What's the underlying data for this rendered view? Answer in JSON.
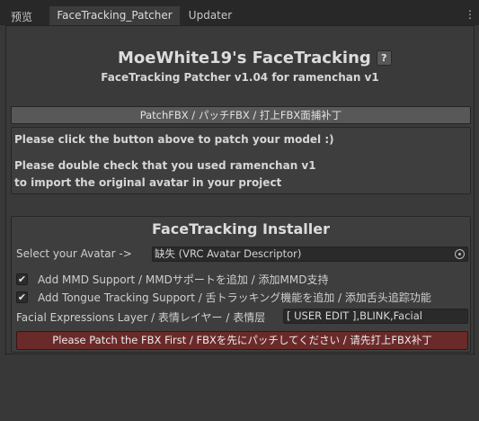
{
  "tabs": [
    {
      "label": "预览"
    },
    {
      "label": "FaceTracking_Patcher"
    },
    {
      "label": "Updater"
    }
  ],
  "tab_menu_glyph": "⋮",
  "header": {
    "title": "MoeWhite19's FaceTracking",
    "help_label": "?",
    "subtitle": "FaceTracking Patcher v1.04 for ramenchan v1"
  },
  "patch": {
    "button_label": "PatchFBX / パッチFBX / 打上FBX面捕补丁",
    "info_line1": "Please click the button above to patch your model :)",
    "info_line2": "Please double check that you used ramenchan v1",
    "info_line3": "to import the original avatar in your project"
  },
  "installer": {
    "title": "FaceTracking Installer",
    "avatar_label": "Select your Avatar ->",
    "avatar_value": "缺失 (VRC Avatar Descriptor)",
    "mmd_checked": true,
    "mmd_label": "Add MMD Support / MMDサポートを追加 / 添加MMD支持",
    "tongue_checked": true,
    "tongue_label": "Add Tongue Tracking Support / 舌トラッキング機能を追加 / 添加舌头追踪功能",
    "facial_label": "Facial Expressions Layer / 表情レイヤー / 表情层",
    "facial_value": "[ USER EDIT ],BLINK,Facial",
    "warning_label": "Please Patch the FBX First / FBXを先にパッチしてください / 请先打上FBX补丁",
    "check_glyph": "✔"
  },
  "colors": {
    "background": "#383838",
    "tabbar": "#282828",
    "warning_button": "#6b2a2a"
  }
}
